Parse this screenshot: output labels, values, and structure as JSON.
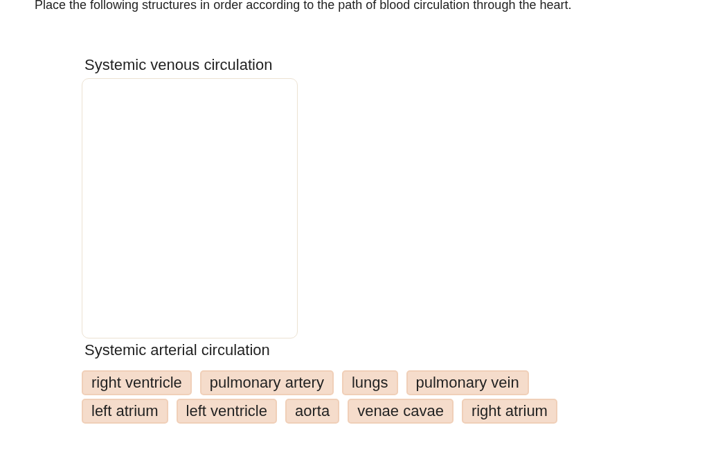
{
  "instruction": "Place the following structures in order according to the path of blood circulation through the heart.",
  "top_label": "Systemic venous circulation",
  "bottom_label": "Systemic arterial circulation",
  "choices": [
    {
      "label": "right ventricle"
    },
    {
      "label": "pulmonary artery"
    },
    {
      "label": "lungs"
    },
    {
      "label": "pulmonary vein"
    },
    {
      "label": "left atrium"
    },
    {
      "label": "left ventricle"
    },
    {
      "label": "aorta"
    },
    {
      "label": "venae cavae"
    },
    {
      "label": "right atrium"
    }
  ]
}
